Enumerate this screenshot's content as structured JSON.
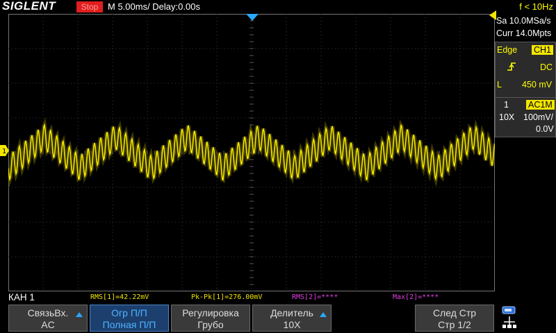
{
  "header": {
    "brand": "SIGLENT",
    "run_state": "Stop",
    "timebase": "M 5.00ms/ Delay:0.00s",
    "trigger_freq": "f < 10Hz"
  },
  "acquisition": {
    "sample_rate": "Sa 10.0MSa/s",
    "memory_depth": "Curr 14.0Mpts"
  },
  "trigger": {
    "type": "Edge",
    "source": "CH1",
    "slope_icon": "rising-edge-icon",
    "coupling": "DC",
    "level_label": "L",
    "level": "450 mV"
  },
  "channel1": {
    "number": "1",
    "coupling_tag": "AC1M",
    "probe": "10X",
    "scale": "100mV/",
    "offset": "0.0V",
    "marker": "1",
    "color": "#f2e600"
  },
  "measurements": {
    "channel_label": "КАН 1",
    "items": [
      {
        "text": "RMS[1]=42.22mV",
        "color": "#f2e600"
      },
      {
        "text": "Pk-Pk[1]=276.00mV",
        "color": "#f2e600"
      },
      {
        "text": "RMS[2]=****",
        "color": "#e040e0"
      },
      {
        "text": "Max[2]=****",
        "color": "#e040e0"
      }
    ]
  },
  "softkeys": [
    {
      "line1": "СвязьВх.",
      "line2": "AC"
    },
    {
      "line1": "Огр П/П",
      "line2": "Полная П/П"
    },
    {
      "line1": "Регулировка",
      "line2": "Грубо"
    },
    {
      "line1": "Делитель",
      "line2": "10X"
    },
    {
      "line1": "",
      "line2": ""
    },
    {
      "line1": "След Стр",
      "line2": "Стр 1/2"
    }
  ],
  "colors": {
    "trace": "#f2e600",
    "graticule": "#3c3c3c",
    "accent_blue": "#2aa8ff",
    "stop_red": "#e01e1e"
  },
  "waveform": {
    "description_free": true,
    "carrier_cycles_per_div": 3.0,
    "ripple_cycles_per_div": 24,
    "carrier_amplitude_div": 0.5,
    "ripple_amplitude_div": 0.4
  }
}
